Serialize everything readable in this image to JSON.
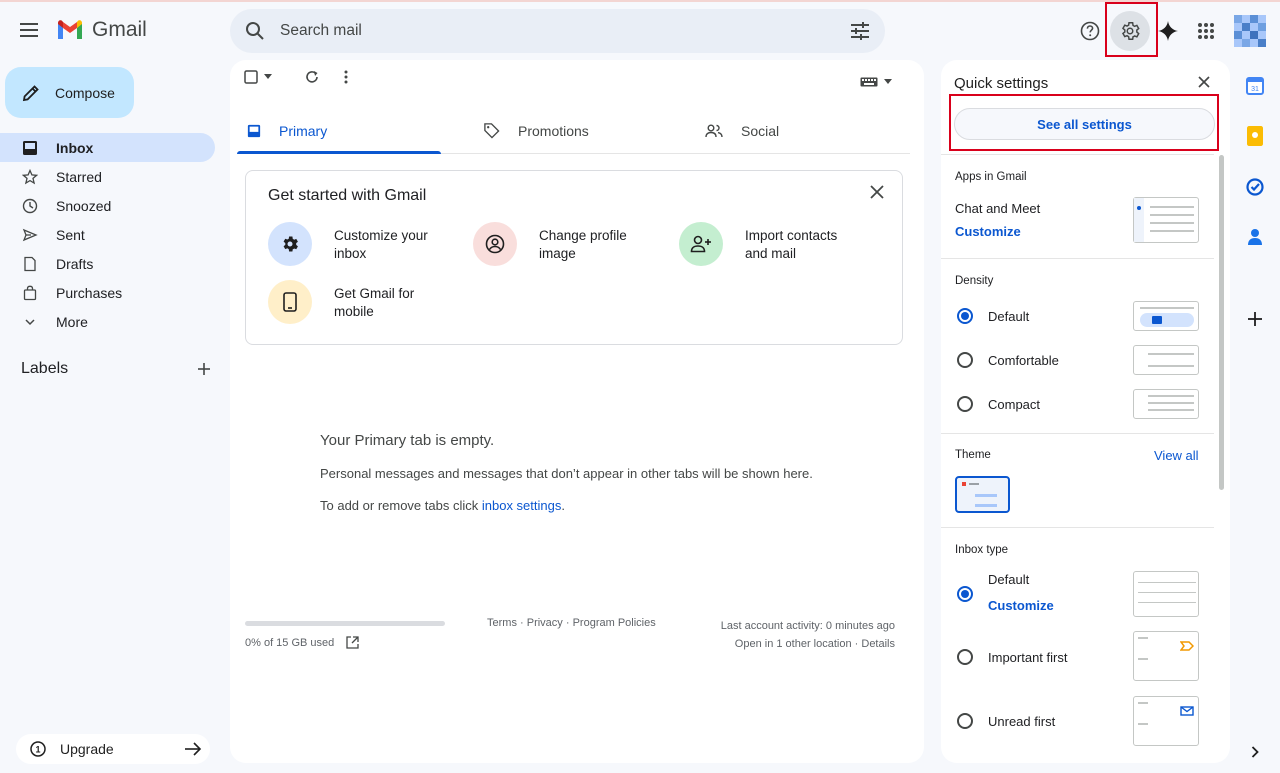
{
  "header": {
    "app_name": "Gmail",
    "search_placeholder": "Search mail"
  },
  "sidebar": {
    "compose_label": "Compose",
    "items": [
      {
        "label": "Inbox",
        "icon": "inbox-icon",
        "active": true
      },
      {
        "label": "Starred",
        "icon": "star-icon"
      },
      {
        "label": "Snoozed",
        "icon": "clock-icon"
      },
      {
        "label": "Sent",
        "icon": "send-icon"
      },
      {
        "label": "Drafts",
        "icon": "draft-icon"
      },
      {
        "label": "Purchases",
        "icon": "bag-icon"
      },
      {
        "label": "More",
        "icon": "chevron-down-icon"
      }
    ],
    "labels_heading": "Labels",
    "upgrade_label": "Upgrade"
  },
  "tabs": [
    {
      "label": "Primary",
      "icon": "inbox-icon",
      "active": true
    },
    {
      "label": "Promotions",
      "icon": "tag-icon"
    },
    {
      "label": "Social",
      "icon": "people-icon"
    }
  ],
  "get_started": {
    "title": "Get started with Gmail",
    "items": [
      {
        "label": "Customize your inbox",
        "icon": "gear-icon",
        "color": "#d3e3fd"
      },
      {
        "label": "Change profile image",
        "icon": "account-circle-icon",
        "color": "#f9dedc"
      },
      {
        "label": "Import contacts and mail",
        "icon": "person-add-icon",
        "color": "#c4eed0"
      },
      {
        "label": "Get Gmail for mobile",
        "icon": "phone-icon",
        "color": "#ffefc9"
      }
    ]
  },
  "empty_state": {
    "title": "Your Primary tab is empty.",
    "line1": "Personal messages and messages that don’t appear in other tabs will be shown here.",
    "line2_prefix": "To add or remove tabs click ",
    "line2_link": "inbox settings",
    "line2_suffix": "."
  },
  "footer": {
    "storage": "0% of 15 GB used",
    "storage_fraction": 0,
    "terms": "Terms",
    "privacy": "Privacy",
    "policies": "Program Policies",
    "sep": " · ",
    "activity": "Last account activity: 0 minutes ago",
    "other_location": "Open in 1 other location",
    "details": "Details"
  },
  "quick_settings": {
    "title": "Quick settings",
    "see_all": "See all settings",
    "apps_heading": "Apps in Gmail",
    "chat_meet": "Chat and Meet",
    "customize": "Customize",
    "density_heading": "Density",
    "density_options": [
      {
        "label": "Default",
        "selected": true
      },
      {
        "label": "Comfortable",
        "selected": false
      },
      {
        "label": "Compact",
        "selected": false
      }
    ],
    "theme_heading": "Theme",
    "view_all": "View all",
    "inbox_type_heading": "Inbox type",
    "inbox_options": [
      {
        "label": "Default",
        "selected": true
      },
      {
        "label": "Important first",
        "selected": false
      },
      {
        "label": "Unread first",
        "selected": false
      }
    ],
    "inbox_customize": "Customize"
  },
  "colors": {
    "accent": "#0b57d0",
    "highlight": "#d9001b"
  }
}
